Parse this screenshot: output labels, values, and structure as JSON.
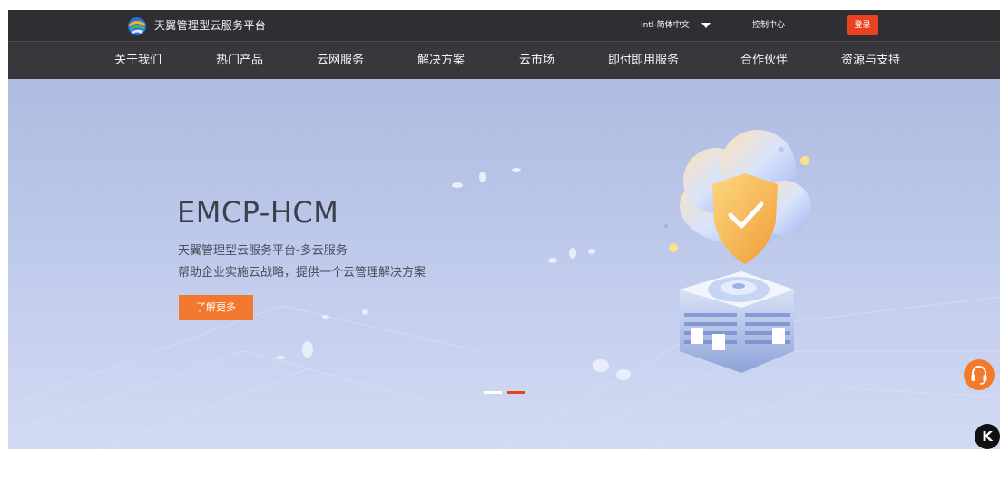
{
  "header": {
    "brand": "天翼管理型云服务平台",
    "language": "Intl-简体中文",
    "console": "控制中心",
    "login": "登录"
  },
  "nav": {
    "items": [
      {
        "label": "关于我们"
      },
      {
        "label": "热门产品"
      },
      {
        "label": "云网服务"
      },
      {
        "label": "解决方案"
      },
      {
        "label": "云市场"
      },
      {
        "label": "即付即用服务"
      },
      {
        "label": "合作伙伴"
      },
      {
        "label": "资源与支持"
      }
    ]
  },
  "hero": {
    "title": "EMCP-HCM",
    "subtitle_1": "天翼管理型云服务平台-多云服务",
    "subtitle_2": "帮助企业实施云战略，提供一个云管理解决方案",
    "cta": "了解更多"
  },
  "floating": {
    "k_badge": "K"
  },
  "colors": {
    "topbar": "#2f2f33",
    "nav": "#38383c",
    "accent_red": "#e8421f",
    "accent_orange": "#f1782e"
  },
  "icons": [
    "logo-icon",
    "chevron-down-icon",
    "headset-icon",
    "k-icon"
  ]
}
